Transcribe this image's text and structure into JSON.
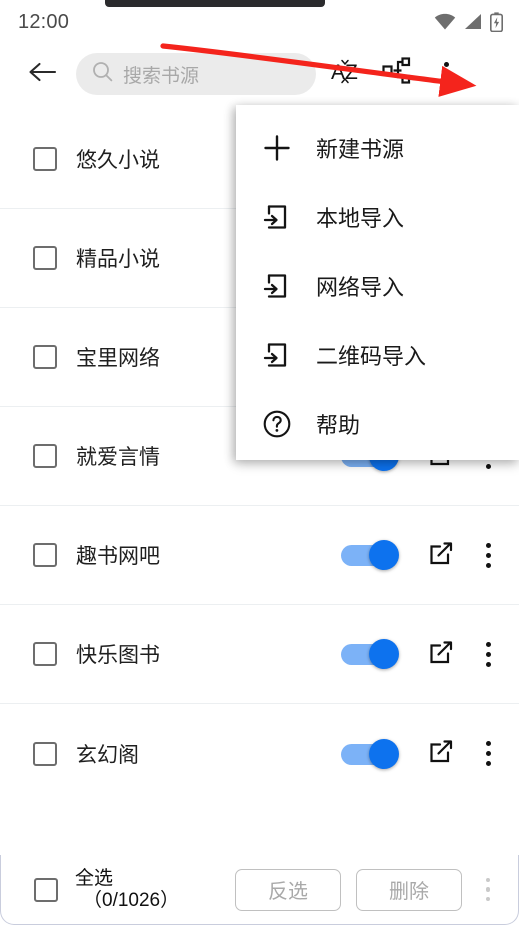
{
  "statusbar": {
    "time": "12:00",
    "icons": [
      "wifi-icon",
      "signal-icon",
      "battery-charging-icon"
    ]
  },
  "toolbar": {
    "back_icon": "back-arrow-icon",
    "search": {
      "icon": "search-icon",
      "placeholder": "搜索书源",
      "value": ""
    },
    "sort_icon_label": "AZ",
    "sort_icon": "sort-az-icon",
    "qr_icon": "qr-code-icon",
    "overflow_icon": "more-vertical-icon"
  },
  "menu": {
    "items": [
      {
        "icon": "plus-icon",
        "label": "新建书源"
      },
      {
        "icon": "import-arrow-icon",
        "label": "本地导入"
      },
      {
        "icon": "import-arrow-icon",
        "label": "网络导入"
      },
      {
        "icon": "import-arrow-icon",
        "label": "二维码导入"
      },
      {
        "icon": "help-circle-icon",
        "label": "帮助"
      }
    ]
  },
  "list": {
    "rows": [
      {
        "label": "悠久小说",
        "checked": false,
        "enabled": true
      },
      {
        "label": "精品小说",
        "checked": false,
        "enabled": true
      },
      {
        "label": "宝里网络",
        "checked": false,
        "enabled": true
      },
      {
        "label": "就爱言情",
        "checked": false,
        "enabled": true
      },
      {
        "label": "趣书网吧",
        "checked": false,
        "enabled": true
      },
      {
        "label": "快乐图书",
        "checked": false,
        "enabled": true
      },
      {
        "label": "玄幻阁",
        "checked": false,
        "enabled": true
      }
    ],
    "row_edit_icon": "edit-square-icon",
    "row_menu_icon": "more-vertical-icon"
  },
  "bottombar": {
    "select_all_label": "全选",
    "select_all_count": "（0/1026）",
    "invert_label": "反选",
    "delete_label": "删除",
    "overflow_icon": "more-vertical-icon"
  },
  "colors": {
    "accent_blue": "#0d72ee",
    "track_blue": "#7cb2f7",
    "annotation_red": "#f4241c",
    "divider": "#eceff1",
    "search_bg": "#ebebeb"
  },
  "annotation": {
    "type": "arrow",
    "color": "#f4241c",
    "from": "搜索书源 区域上方",
    "to": "overflow-menu-button"
  }
}
